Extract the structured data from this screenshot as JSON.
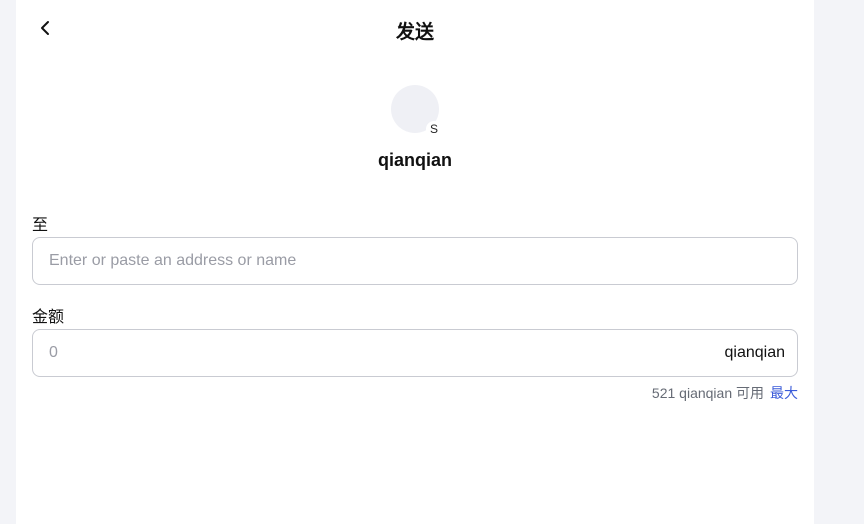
{
  "header": {
    "title": "发送",
    "back_icon": "chevron-left-icon"
  },
  "account": {
    "avatar_badge": "S",
    "name": "qianqian"
  },
  "to_field": {
    "label": "至",
    "value": "",
    "placeholder": "Enter or paste an address or name"
  },
  "amount_field": {
    "label": "金额",
    "value": "",
    "placeholder": "0",
    "unit": "qianqian"
  },
  "balance": {
    "available_text": "521 qianqian 可用",
    "max_label": "最大"
  },
  "colors": {
    "background": "#f3f4f8",
    "panel": "#ffffff",
    "accent_link": "#3a5bd9",
    "border": "#c9cbd2"
  }
}
